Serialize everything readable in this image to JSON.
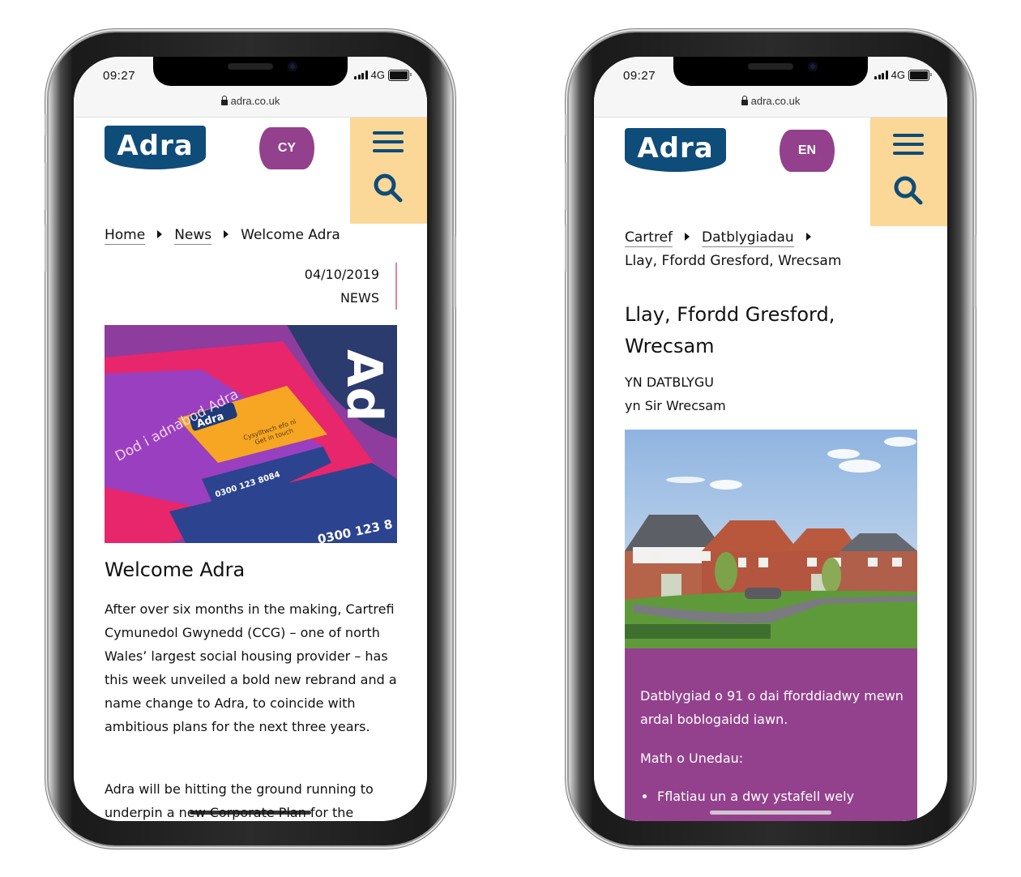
{
  "phones": [
    {
      "status": {
        "time": "09:27",
        "network": "4G"
      },
      "browser": {
        "url": "adra.co.uk"
      },
      "header": {
        "logo": "Adra",
        "language_toggle": "CY"
      },
      "breadcrumb": {
        "items": [
          {
            "label": "Home",
            "link": true
          },
          {
            "label": "News",
            "link": true
          },
          {
            "label": "Welcome Adra",
            "link": false
          }
        ]
      },
      "meta": {
        "date": "04/10/2019",
        "category": "NEWS"
      },
      "article": {
        "image_alt": "Adra branded leaflets and cards",
        "image_texts": {
          "card": "Adra",
          "card_line1": "Cysylltwch efo ni",
          "card_line2": "Get in touch",
          "leaflet": "Dod i adnabod Adra",
          "phone": "0300 123 8084"
        },
        "title": "Welcome Adra",
        "paragraphs": [
          "After over six months in the making, Cartrefi Cymunedol Gwynedd (CCG) – one of north Wales’ largest social housing provider – has this week unveiled a bold new rebrand and a name change to Adra, to coincide with ambitious plans for the next three years.",
          "Adra will be hitting the ground running to underpin a new Corporate Plan for the"
        ]
      }
    },
    {
      "status": {
        "time": "09:27",
        "network": "4G"
      },
      "browser": {
        "url": "adra.co.uk"
      },
      "header": {
        "logo": "Adra",
        "language_toggle": "EN"
      },
      "breadcrumb": {
        "items": [
          {
            "label": "Cartref",
            "link": true
          },
          {
            "label": "Datblygiadau",
            "link": true
          },
          {
            "label": "Llay, Ffordd Gresford, Wrecsam",
            "link": false
          }
        ]
      },
      "development": {
        "title": "Llay, Ffordd Gresford, Wrecsam",
        "status": "YN DATBLYGU",
        "location": "yn Sir Wrecsam",
        "image_alt": "Render of new red-brick houses",
        "description": "Datblygiad o 91 o dai fforddiadwy mewn ardal boblogaidd iawn.",
        "units_heading": "Math o Unedau:",
        "units": [
          "Fflatiau un a dwy ystafell wely"
        ]
      }
    }
  ],
  "colors": {
    "brand_blue": "#0e4c79",
    "brand_purple": "#93418d",
    "menu_panel": "#fbd898",
    "meta_rule": "#e8829e"
  }
}
